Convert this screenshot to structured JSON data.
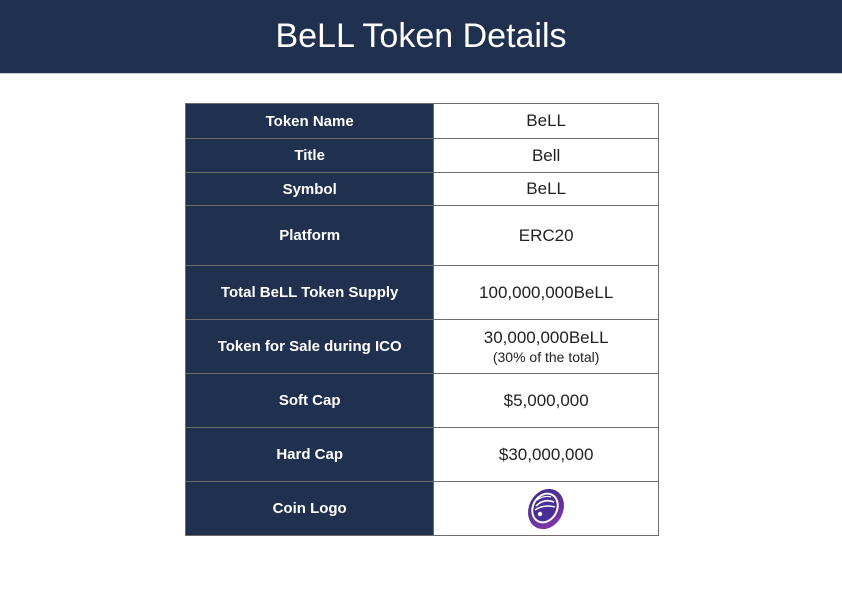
{
  "header": {
    "title": "BeLL Token Details"
  },
  "table": {
    "rows": [
      {
        "label": "Token Name",
        "value": "BeLL"
      },
      {
        "label": "Title",
        "value": "Bell"
      },
      {
        "label": "Symbol",
        "value": "BeLL"
      },
      {
        "label": "Platform",
        "value": "ERC20"
      },
      {
        "label": "Total BeLL Token Supply",
        "value": "100,000,000BeLL"
      },
      {
        "label": "Token for Sale during ICO",
        "value": "30,000,000BeLL",
        "subvalue": "(30% of the total)"
      },
      {
        "label": "Soft Cap",
        "value": "$5,000,000"
      },
      {
        "label": "Hard Cap",
        "value": "$30,000,000"
      },
      {
        "label": "Coin Logo",
        "value_icon": "bell-coin-logo-icon"
      }
    ]
  },
  "colors": {
    "header_bg": "#20304f",
    "label_bg": "#20304f",
    "logo_purple": "#5b2d9c"
  }
}
